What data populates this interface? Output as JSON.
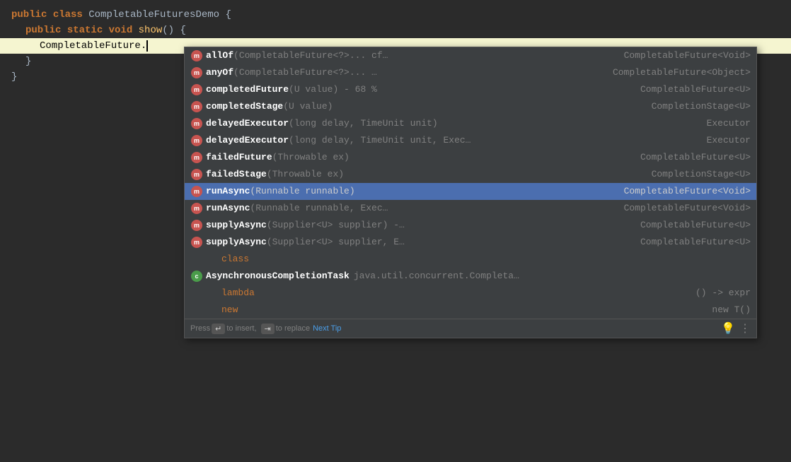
{
  "editor": {
    "lines": [
      {
        "id": 1,
        "indent": 0,
        "tokens": [
          {
            "type": "kw-public",
            "text": "public "
          },
          {
            "type": "kw-class",
            "text": "class "
          },
          {
            "type": "plain",
            "text": "CompletableFuturesDemo "
          },
          {
            "type": "punctuation",
            "text": "{"
          }
        ]
      },
      {
        "id": 2,
        "indent": 1,
        "tokens": [
          {
            "type": "kw-public",
            "text": "public "
          },
          {
            "type": "kw-static",
            "text": "static "
          },
          {
            "type": "kw-void",
            "text": "void "
          },
          {
            "type": "method-name",
            "text": "show"
          },
          {
            "type": "punctuation",
            "text": "() {"
          }
        ]
      },
      {
        "id": 3,
        "indent": 2,
        "highlighted": true,
        "tokens": [
          {
            "type": "plain",
            "text": "CompletableFuture."
          },
          {
            "type": "cursor",
            "text": ""
          }
        ]
      },
      {
        "id": 4,
        "indent": 1,
        "tokens": [
          {
            "type": "punctuation",
            "text": "}"
          }
        ]
      },
      {
        "id": 5,
        "indent": 0,
        "tokens": [
          {
            "type": "punctuation",
            "text": "}"
          }
        ]
      }
    ]
  },
  "autocomplete": {
    "items": [
      {
        "id": "allOf",
        "type": "method",
        "name": "allOf",
        "params": "(CompletableFuture<?>... cf…",
        "returnType": "CompletableFuture<Void>",
        "selected": false
      },
      {
        "id": "anyOf",
        "type": "method",
        "name": "anyOf",
        "params": "(CompletableFuture<?>... …",
        "returnType": "CompletableFuture<Object>",
        "selected": false
      },
      {
        "id": "completedFuture",
        "type": "method",
        "name": "completedFuture",
        "params": "(U value) - 68 %",
        "returnType": "CompletableFuture<U>",
        "selected": false
      },
      {
        "id": "completedStage",
        "type": "method",
        "name": "completedStage",
        "params": "(U value)",
        "returnType": "CompletionStage<U>",
        "selected": false
      },
      {
        "id": "delayedExecutor1",
        "type": "method",
        "name": "delayedExecutor",
        "params": "(long delay, TimeUnit unit)",
        "returnType": "Executor",
        "selected": false
      },
      {
        "id": "delayedExecutor2",
        "type": "method",
        "name": "delayedExecutor",
        "params": "(long delay, TimeUnit unit, Exec…",
        "returnType": "Executor",
        "selected": false
      },
      {
        "id": "failedFuture",
        "type": "method",
        "name": "failedFuture",
        "params": "(Throwable ex)",
        "returnType": "CompletableFuture<U>",
        "selected": false
      },
      {
        "id": "failedStage",
        "type": "method",
        "name": "failedStage",
        "params": "(Throwable ex)",
        "returnType": "CompletionStage<U>",
        "selected": false
      },
      {
        "id": "runAsync1",
        "type": "method",
        "name": "runAsync",
        "params": "(Runnable runnable)",
        "returnType": "CompletableFuture<Void>",
        "selected": true
      },
      {
        "id": "runAsync2",
        "type": "method",
        "name": "runAsync",
        "params": "(Runnable runnable, Exec…",
        "returnType": "CompletableFuture<Void>",
        "selected": false
      },
      {
        "id": "supplyAsync1",
        "type": "method",
        "name": "supplyAsync",
        "params": "(Supplier<U> supplier) -…",
        "returnType": "CompletableFuture<U>",
        "selected": false
      },
      {
        "id": "supplyAsync2",
        "type": "method",
        "name": "supplyAsync",
        "params": "(Supplier<U> supplier, E…",
        "returnType": "CompletableFuture<U>",
        "selected": false
      },
      {
        "id": "class",
        "type": "keyword",
        "name": "class",
        "params": "",
        "returnType": "",
        "selected": false
      },
      {
        "id": "AsynchronousCompletionTask",
        "type": "class",
        "name": "AsynchronousCompletionTask",
        "params": "java.util.concurrent.Completa…",
        "returnType": "",
        "selected": false
      },
      {
        "id": "lambda",
        "type": "keyword",
        "name": "lambda",
        "params": "",
        "returnType": "() -> expr",
        "selected": false
      },
      {
        "id": "new",
        "type": "keyword",
        "name": "new",
        "params": "",
        "returnType": "new T()",
        "selected": false
      }
    ],
    "footer": {
      "pressText": "Press",
      "insertKey": "↵",
      "insertLabel": "to insert,",
      "replaceKey": "⇥",
      "replaceLabel": "to replace",
      "nextTipLabel": "Next Tip"
    }
  }
}
